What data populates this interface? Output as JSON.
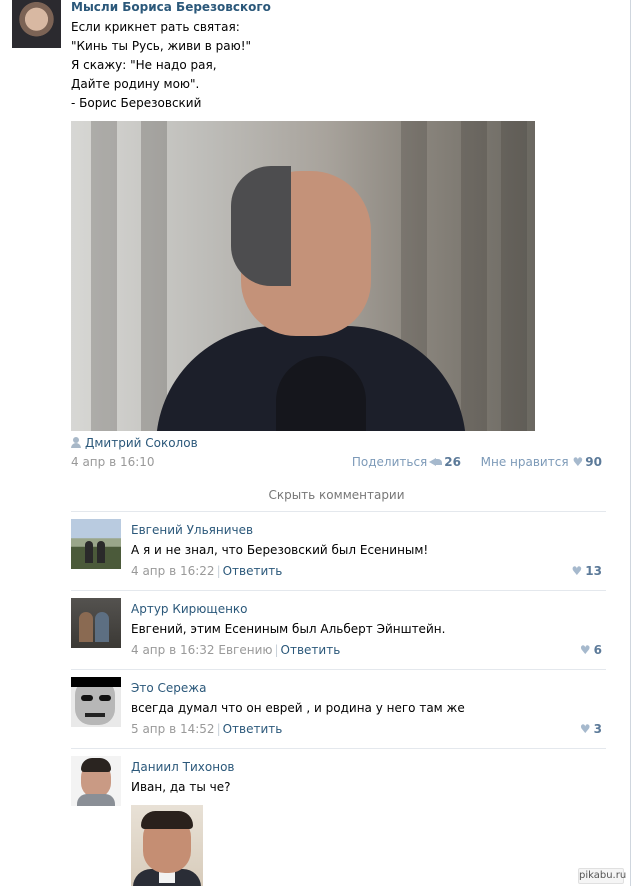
{
  "post": {
    "author": "Мысли Бориса Березовского",
    "text": "Если крикнет рать святая:\n\"Кинь ты Русь, живи в раю!\"\nЯ скажу: \"Не надо рая,\nДайте родину мою\".\n- Борис Березовский",
    "attribution": "Дмитрий Соколов",
    "date": "4 апр в 16:10",
    "share_label": "Поделиться",
    "share_count": "26",
    "like_label": "Мне нравится",
    "like_count": "90"
  },
  "hide_comments_label": "Скрыть комментарии",
  "comments": [
    {
      "name": "Евгений Ульяничев",
      "text": "А я и не знал, что Березовский был Есениным!",
      "date": "4 апр в 16:22",
      "reply_to": "",
      "reply_label": "Ответить",
      "likes": "13"
    },
    {
      "name": "Артур Кирющенко",
      "text": "Евгений, этим Есениным был Альберт Эйнштейн.",
      "date": "4 апр в 16:32",
      "reply_to": "Евгению",
      "reply_label": "Ответить",
      "likes": "6"
    },
    {
      "name": "Это Сережа",
      "text": "всегда думал что он еврей , и родина у него там же",
      "date": "5 апр в 14:52",
      "reply_to": "",
      "reply_label": "Ответить",
      "likes": "3"
    },
    {
      "name": "Даниил Тихонов",
      "text": "Иван, да ты че?"
    }
  ],
  "icons": {
    "share": "megaphone-icon",
    "like": "heart-icon",
    "person": "person-icon"
  },
  "colors": {
    "link": "#2b587a",
    "muted": "#999999",
    "count": "#5c7a99",
    "icon": "#a6b9cd"
  },
  "watermark": "pikabu.ru"
}
